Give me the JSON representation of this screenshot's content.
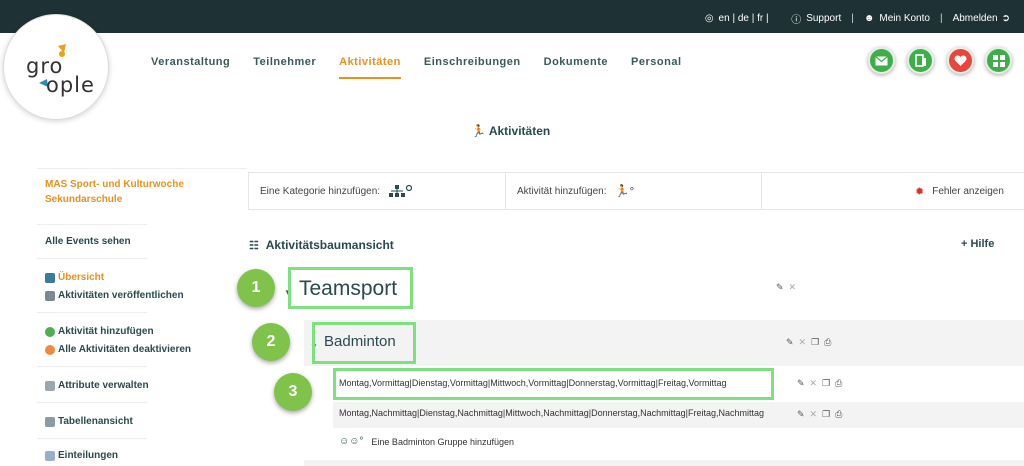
{
  "topbar": {
    "languages": "en | de | fr |",
    "support": "Support",
    "account": "Mein Konto",
    "logout": "Abmelden",
    "separator": "|"
  },
  "logo": {
    "text_line1": "gro",
    "text_line2": "ople"
  },
  "nav": [
    {
      "label": "Veranstaltung"
    },
    {
      "label": "Teilnehmer"
    },
    {
      "label": "Aktivitäten",
      "active": true
    },
    {
      "label": "Einschreibungen"
    },
    {
      "label": "Dokumente"
    },
    {
      "label": "Personal"
    }
  ],
  "quick_buttons": [
    {
      "icon": "mail-icon",
      "color": "#3fae4a"
    },
    {
      "icon": "door-exit-icon",
      "color": "#3fae4a"
    },
    {
      "icon": "heart-icon",
      "color": "#e8453c"
    },
    {
      "icon": "grid-icon",
      "color": "#3fae4a"
    }
  ],
  "page": {
    "title": "Aktivitäten",
    "title_icon": "running-person-icon"
  },
  "sidebar": {
    "event_name": "MAS Sport- und Kulturwoche Sekundarschule",
    "all_events": "Alle Events sehen",
    "overview": "Übersicht",
    "publish": "Aktivitäten veröffentlichen",
    "add_activity": "Aktivität hinzufügen",
    "deactivate_all": "Alle Aktivitäten deaktivieren",
    "manage_attributes": "Attribute verwalten",
    "table_view": "Tabellenansicht",
    "assignments": "Einteilungen"
  },
  "toolbar": {
    "add_category": "Eine Kategorie hinzufügen:",
    "add_activity": "Aktivität hinzufügen:",
    "show_errors": "Fehler anzeigen"
  },
  "tree": {
    "title": "Aktivitätsbaumansicht",
    "help": "+ Hilfe",
    "category": "Teamsport",
    "activity": "Badminton",
    "slots": [
      "Montag,Vormittag|Dienstag,Vormittag|Mittwoch,Vormittag|Donnerstag,Vormittag|Freitag,Vormittag",
      "Montag,Nachmittag|Dienstag,Nachmittag|Mittwoch,Nachmittag|Donnerstag,Nachmittag|Freitag,Nachmittag"
    ],
    "add_group": "Eine Badminton Gruppe hinzufügen"
  },
  "callouts": [
    "1",
    "2",
    "3"
  ],
  "colors": {
    "topbar": "#1e3134",
    "accent": "#e8911e",
    "highlight": "#7fe07f",
    "badge": "#7fc34a",
    "error": "#d9342b"
  }
}
